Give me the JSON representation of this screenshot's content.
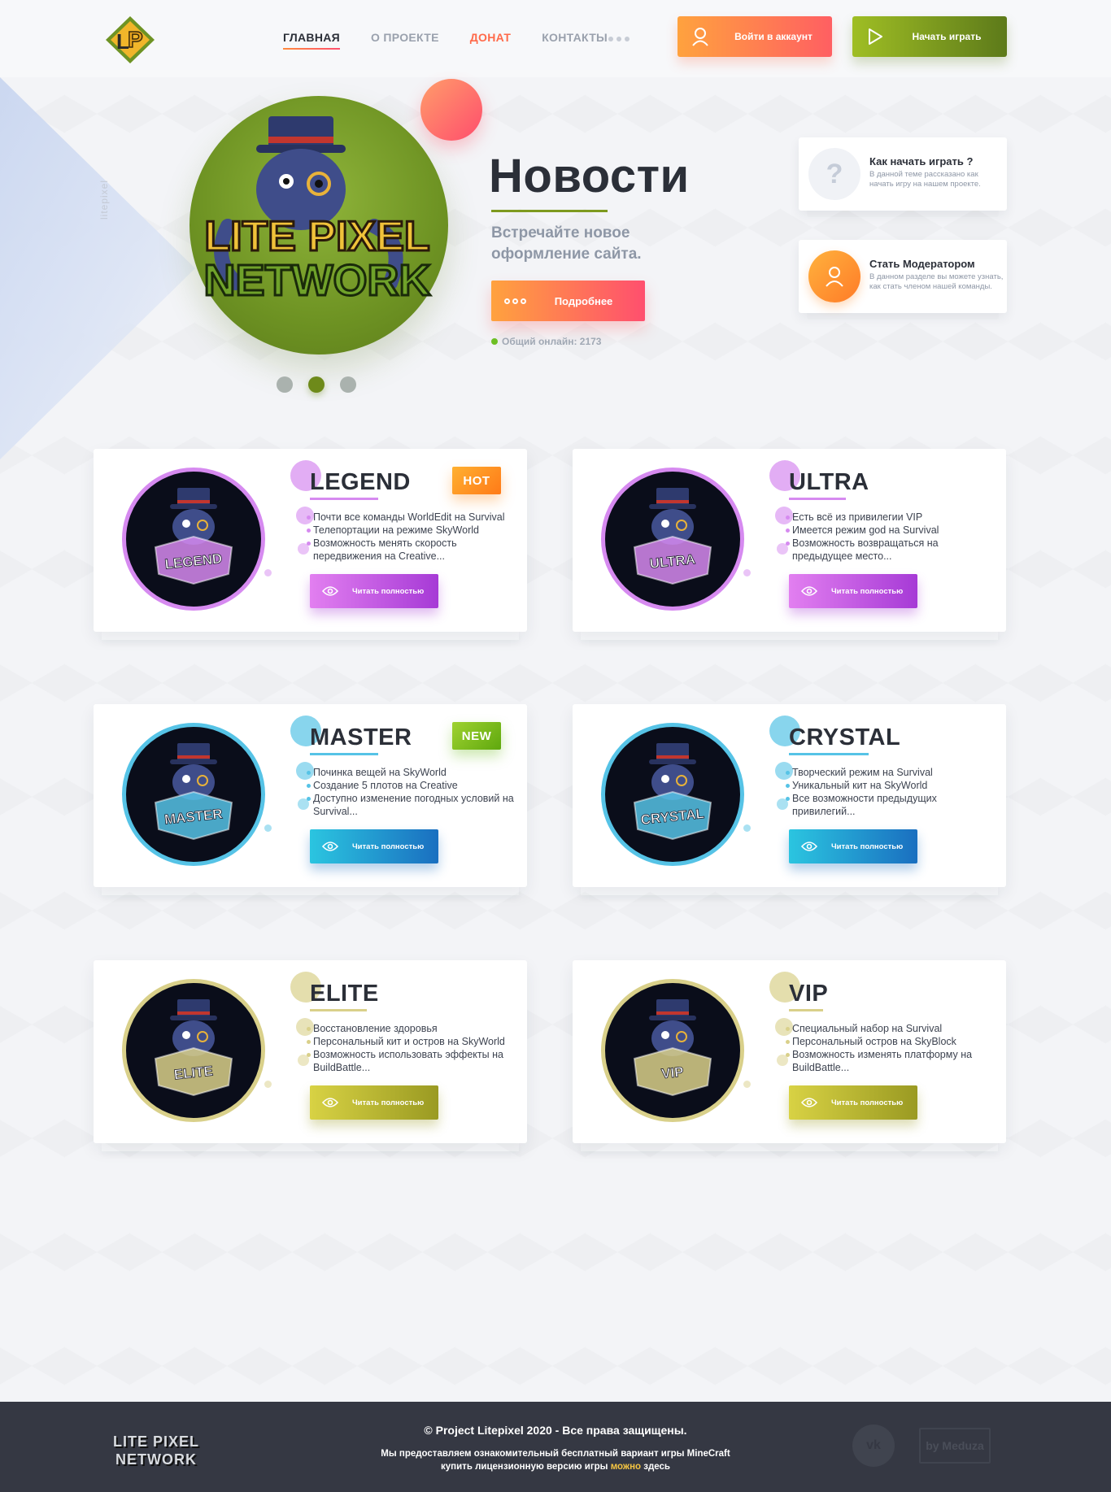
{
  "header": {
    "nav": [
      {
        "label": "ГЛАВНАЯ"
      },
      {
        "label": "О ПРОЕКТЕ"
      },
      {
        "label": "ДОНАТ"
      },
      {
        "label": "КОНТАКТЫ"
      }
    ],
    "login_label": "Войти в аккаунт",
    "play_label": "Начать играть"
  },
  "hero": {
    "side_label": "litepixel",
    "title": "Новости",
    "subtitle": "Встречайте новое оформление сайта.",
    "more_label": "Подробнее",
    "online_label": "Общий онлайн: 2173",
    "logo_line1": "LITE PIXEL",
    "logo_line2": "NETWORK"
  },
  "info_cards": [
    {
      "title": "Как начать играть ?",
      "desc": "В данной теме рассказано как начать игру на нашем проекте.",
      "icon": "question-icon"
    },
    {
      "title": "Стать Модератором",
      "desc": "В данном разделе вы можете узнать, как стать членом нашей команды.",
      "icon": "user-icon"
    }
  ],
  "privileges": [
    {
      "name": "LEGEND",
      "badge": "HOT",
      "emblem": "LEGEND",
      "color": "#d68af0",
      "btn": [
        "#e27ff0",
        "#a63ad6"
      ],
      "items": [
        "Почти все команды WorldEdit на Survival",
        "Телепортации на режиме SkyWorld",
        "Возможность менять скорость передвижения на Creative..."
      ],
      "read_label": "Читать полностью"
    },
    {
      "name": "ULTRA",
      "badge": "",
      "emblem": "ULTRA",
      "color": "#d68af0",
      "btn": [
        "#e27ff0",
        "#a63ad6"
      ],
      "items": [
        "Есть всё из привилегии VIP",
        "Имеется режим god на Survival",
        "Возможность возвращаться на предыдущее место..."
      ],
      "read_label": "Читать полностью"
    },
    {
      "name": "MASTER",
      "badge": "NEW",
      "emblem": "MASTER",
      "color": "#56c3e6",
      "btn": [
        "#2bc5e0",
        "#1a6fc0"
      ],
      "items": [
        "Починка вещей на SkyWorld",
        "Создание 5 плотов на Creative",
        "Доступно изменение погодных условий на Survival..."
      ],
      "read_label": "Читать полностью"
    },
    {
      "name": "CRYSTAL",
      "badge": "",
      "emblem": "CRYSTAL",
      "color": "#56c3e6",
      "btn": [
        "#2bc5e0",
        "#1a6fc0"
      ],
      "items": [
        "Творческий режим на Survival",
        "Уникальный кит на SkyWorld",
        "Все возможности предыдущих привилегий..."
      ],
      "read_label": "Читать полностью"
    },
    {
      "name": "ELITE",
      "badge": "",
      "emblem": "ELITE",
      "color": "#d9d08a",
      "btn": [
        "#d8d244",
        "#9a9a22"
      ],
      "items": [
        "Восстановление здоровья",
        "Персональный кит и остров на SkyWorld",
        "Возможность использовать эффекты на BuildBattle..."
      ],
      "read_label": "Читать полностью"
    },
    {
      "name": "VIP",
      "badge": "",
      "emblem": "VIP",
      "color": "#d9d08a",
      "btn": [
        "#d8d244",
        "#9a9a22"
      ],
      "items": [
        "Специальный набор на Survival",
        "Персональный остров на SkyBlock",
        "Возможность изменять платформу на BuildBattle..."
      ],
      "read_label": "Читать полностью"
    }
  ],
  "footer": {
    "logo_line1": "LITE PIXEL",
    "logo_line2": "NETWORK",
    "copyright": "© Project Litepixel 2020 - Все права защищены.",
    "note_line1": "Мы предоставляем ознакомительный бесплатный вариант игры MineCraft",
    "note_line2_a": "купить лицензионную версию игры ",
    "note_line2_link": "можно",
    "note_line2_b": " здесь",
    "vk_label": "vk",
    "by_label": "by Meduza"
  }
}
